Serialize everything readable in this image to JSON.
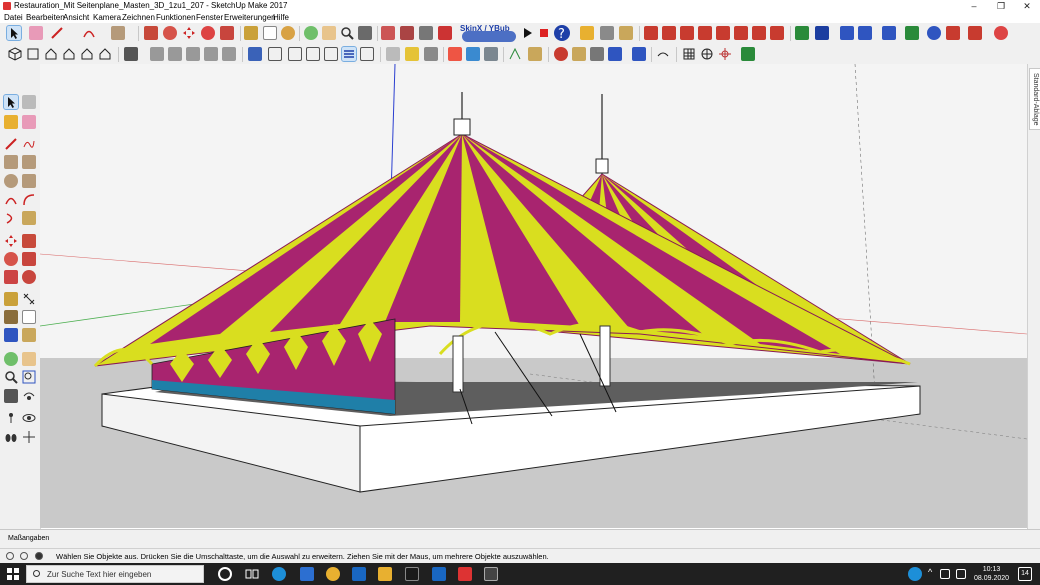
{
  "window": {
    "title": "Restauration_Mit Seitenplane_Masten_3D_1zu1_207 - SketchUp Make 2017",
    "minimize": "–",
    "maximize": "❐",
    "close": "✕"
  },
  "menu": [
    "Datei",
    "Bearbeiten",
    "Ansicht",
    "Kamera",
    "Zeichnen",
    "Funktionen",
    "Fenster",
    "Erweiterungen",
    "Hilfe"
  ],
  "toolbar1": {
    "skinx_label": "SkinX / YBub",
    "icons": [
      "select-icon",
      "eraser-icon",
      "pencil-icon",
      "arc-icon",
      "rectangle-icon",
      "pushpull-icon",
      "rotate-icon",
      "move-icon",
      "scale-icon",
      "offset-icon",
      "tape-icon",
      "text-icon",
      "paint-icon",
      "orbit-icon",
      "pan-icon",
      "zoom-icon",
      "zoom-extents-icon",
      "warehouse-icon",
      "extension-icon"
    ]
  },
  "toolbar2": {
    "icons": [
      "cube-icon",
      "house-icon",
      "front-view-icon",
      "back-view-icon",
      "section-icon",
      "shadow-icon",
      "style-icon",
      "fog-icon",
      "layer-icon",
      "texture-icon",
      "grid-icon",
      "compass-icon",
      "person-icon"
    ]
  },
  "right_panel": {
    "tab_label": "Standard-Ablage"
  },
  "measure": {
    "label": "Maßangaben"
  },
  "status": {
    "message": "Wählen Sie Objekte aus. Drücken Sie die Umschalttaste, um die Auswahl zu erweitern. Ziehen Sie mit der Maus, um mehrere Objekte auszuwählen."
  },
  "taskbar": {
    "search_placeholder": "Zur Suche Text hier eingeben",
    "time": "10:13",
    "date": "08.09.2020",
    "notification_count": "14"
  },
  "colors": {
    "tent_magenta": "#a8246f",
    "tent_yellow": "#d9de1f",
    "trim_blue": "#1f7fa8",
    "selection": "#cfe3f7"
  }
}
